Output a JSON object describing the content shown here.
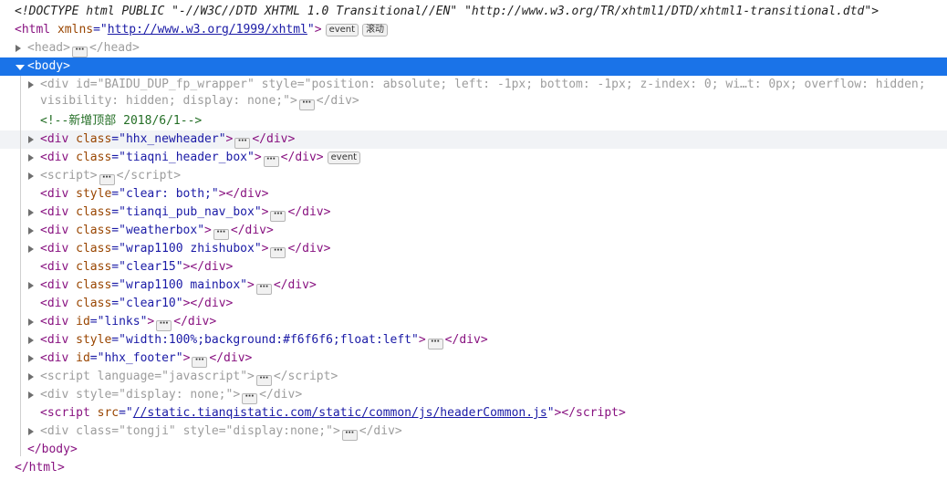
{
  "doctype": "<!DOCTYPE html PUBLIC \"-//W3C//DTD XHTML 1.0 Transitional//EN\" \"http://www.w3.org/TR/xhtml1/DTD/xhtml1-transitional.dtd\">",
  "ellipsis": "⋯",
  "badges": {
    "event": "event",
    "scroll": "滚动"
  },
  "nodes": [
    {
      "kind": "open",
      "indent": 0,
      "tag": "html",
      "attrs": [
        {
          "name": "xmlns",
          "value": "http://www.w3.org/1999/xhtml",
          "link": true
        }
      ],
      "badges": [
        "event",
        "scroll"
      ]
    },
    {
      "kind": "collapsed",
      "indent": 1,
      "tag": "head",
      "attrs": [],
      "faded": true
    },
    {
      "kind": "open",
      "indent": 1,
      "tag": "body",
      "attrs": [],
      "expanded": true,
      "selected": true
    },
    {
      "kind": "collapsed",
      "indent": 2,
      "tag": "div",
      "faded": true,
      "wrap": true,
      "attrs": [
        {
          "name": "id",
          "value": "BAIDU_DUP_fp_wrapper"
        },
        {
          "name": "style",
          "value": "position: absolute; left: -1px; bottom: -1px; z-index: 0; wi…t: 0px; overflow: hidden; visibility: hidden; display: none;"
        }
      ]
    },
    {
      "kind": "comment",
      "indent": 2,
      "text": "<!--新增顶部 2018/6/1-->"
    },
    {
      "kind": "collapsed",
      "indent": 2,
      "tag": "div",
      "attrs": [
        {
          "name": "class",
          "value": "hhx_newheader"
        }
      ],
      "hover": true
    },
    {
      "kind": "collapsed",
      "indent": 2,
      "tag": "div",
      "attrs": [
        {
          "name": "class",
          "value": "tiaqni_header_box"
        }
      ],
      "badges": [
        "event"
      ]
    },
    {
      "kind": "collapsed",
      "indent": 2,
      "tag": "script",
      "attrs": [],
      "faded": true
    },
    {
      "kind": "leaf",
      "indent": 2,
      "tag": "div",
      "attrs": [
        {
          "name": "style",
          "value": "clear: both;"
        }
      ]
    },
    {
      "kind": "collapsed",
      "indent": 2,
      "tag": "div",
      "attrs": [
        {
          "name": "class",
          "value": "tianqi_pub_nav_box"
        }
      ]
    },
    {
      "kind": "collapsed",
      "indent": 2,
      "tag": "div",
      "attrs": [
        {
          "name": "class",
          "value": "weatherbox"
        }
      ]
    },
    {
      "kind": "collapsed",
      "indent": 2,
      "tag": "div",
      "attrs": [
        {
          "name": "class",
          "value": "wrap1100 zhishubox"
        }
      ]
    },
    {
      "kind": "leaf",
      "indent": 2,
      "tag": "div",
      "attrs": [
        {
          "name": "class",
          "value": "clear15"
        }
      ]
    },
    {
      "kind": "collapsed",
      "indent": 2,
      "tag": "div",
      "attrs": [
        {
          "name": "class",
          "value": "wrap1100 mainbox"
        }
      ]
    },
    {
      "kind": "leaf",
      "indent": 2,
      "tag": "div",
      "attrs": [
        {
          "name": "class",
          "value": "clear10"
        }
      ]
    },
    {
      "kind": "collapsed",
      "indent": 2,
      "tag": "div",
      "attrs": [
        {
          "name": "id",
          "value": "links"
        }
      ]
    },
    {
      "kind": "collapsed",
      "indent": 2,
      "tag": "div",
      "attrs": [
        {
          "name": "style",
          "value": "width:100%;background:#f6f6f6;float:left"
        }
      ]
    },
    {
      "kind": "collapsed",
      "indent": 2,
      "tag": "div",
      "attrs": [
        {
          "name": "id",
          "value": "hhx_footer"
        }
      ]
    },
    {
      "kind": "collapsed",
      "indent": 2,
      "tag": "script",
      "attrs": [
        {
          "name": "language",
          "value": "javascript"
        }
      ],
      "faded": true
    },
    {
      "kind": "collapsed",
      "indent": 2,
      "tag": "div",
      "attrs": [
        {
          "name": "style",
          "value": "display: none;"
        }
      ],
      "faded": true
    },
    {
      "kind": "leaf",
      "indent": 2,
      "tag": "script",
      "attrs": [
        {
          "name": "src",
          "value": "//static.tianqistatic.com/static/common/js/headerCommon.js",
          "link": true
        }
      ]
    },
    {
      "kind": "collapsed",
      "indent": 2,
      "tag": "div",
      "attrs": [
        {
          "name": "class",
          "value": "tongji"
        },
        {
          "name": "style",
          "value": "display:none;"
        }
      ],
      "faded": true
    },
    {
      "kind": "close",
      "indent": 1,
      "tag": "body"
    },
    {
      "kind": "close",
      "indent": 0,
      "tag": "html"
    }
  ]
}
